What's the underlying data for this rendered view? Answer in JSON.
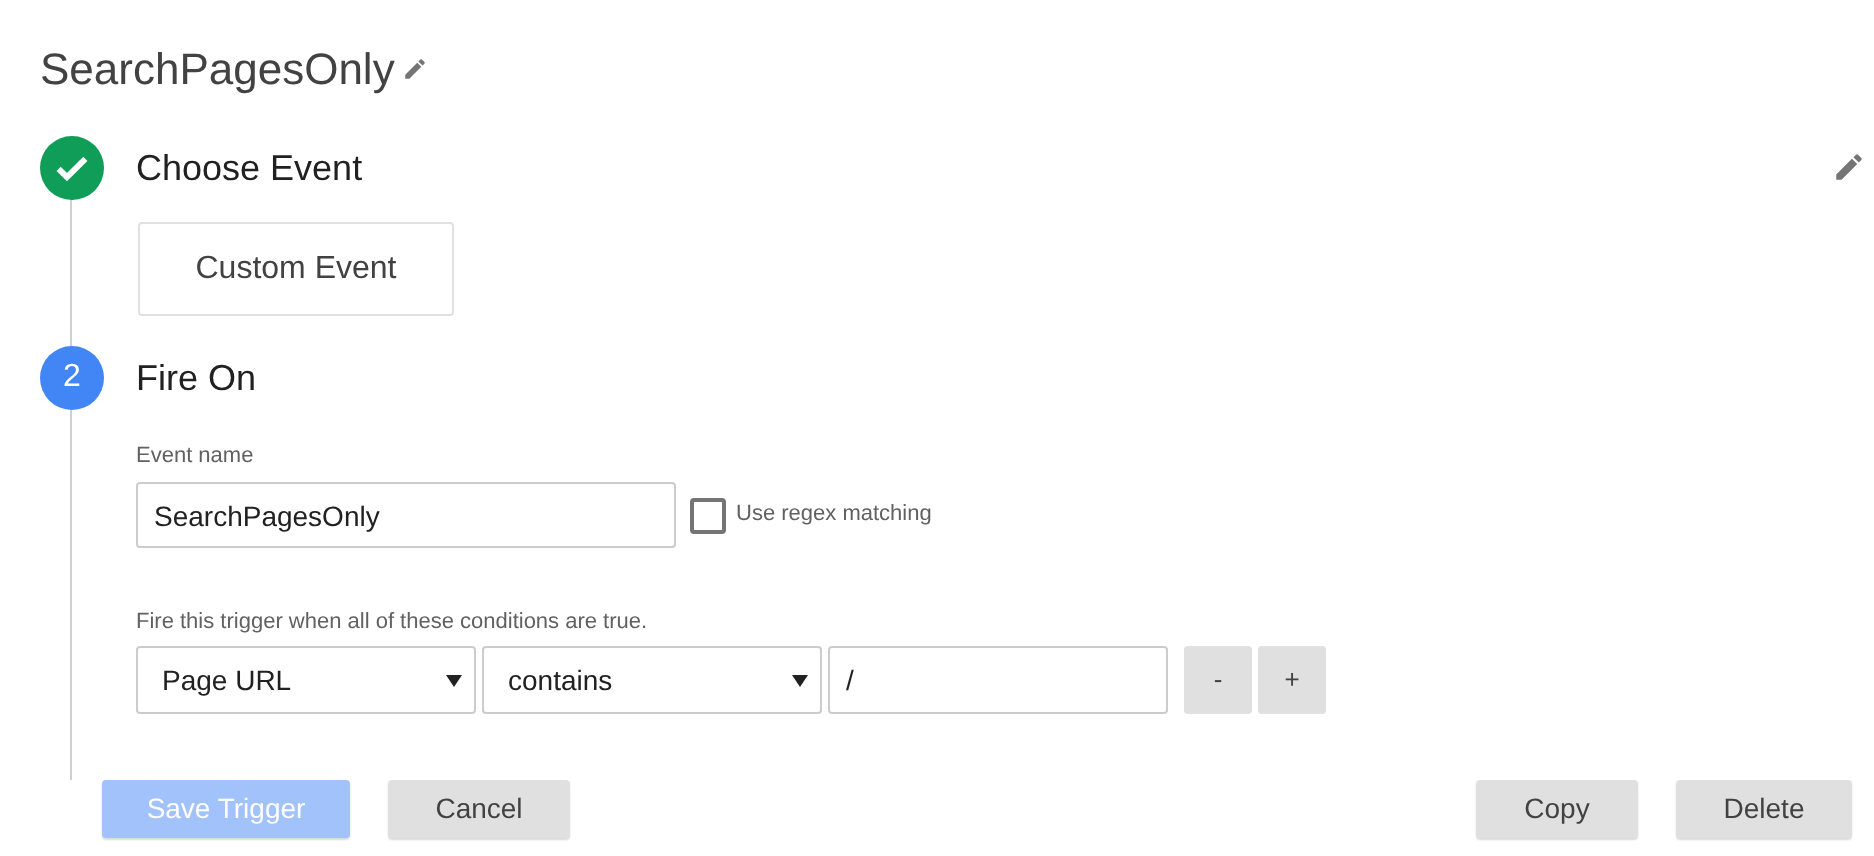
{
  "title": "SearchPagesOnly",
  "steps": [
    {
      "kind": "done",
      "title": "Choose Event",
      "choice": "Custom Event"
    },
    {
      "kind": "active",
      "number": "2",
      "title": "Fire On"
    }
  ],
  "event_name": {
    "label": "Event name",
    "value": "SearchPagesOnly",
    "regex": {
      "label": "Use regex matching",
      "checked": false
    }
  },
  "conditions": {
    "label": "Fire this trigger when all of these conditions are true.",
    "rows": [
      {
        "variable": "Page URL",
        "operator": "contains",
        "value": "/",
        "remove": "-",
        "add": "+"
      }
    ]
  },
  "footer": {
    "left": [
      {
        "label": "Save Trigger",
        "kind": "primary",
        "disabled": true
      },
      {
        "label": "Cancel",
        "kind": "secondary",
        "disabled": false
      }
    ],
    "right": [
      {
        "label": "Copy",
        "kind": "secondary",
        "disabled": false
      },
      {
        "label": "Delete",
        "kind": "secondary",
        "disabled": false
      }
    ]
  }
}
